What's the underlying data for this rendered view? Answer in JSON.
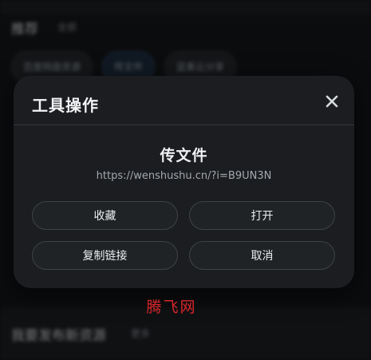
{
  "background": {
    "header_title": "推荐",
    "header_sub": "全部",
    "chips": [
      "百度网盘资源",
      "传文件",
      "蓝奏云分享"
    ],
    "active_chip_index": 1,
    "bottom_title": "我要发布新资源",
    "bottom_sub": "更多"
  },
  "dialog": {
    "title": "工具操作",
    "close_icon": "close-icon",
    "file_name": "传文件",
    "file_url": "https://wenshushu.cn/?i=B9UN3N",
    "actions": {
      "favorite": "收藏",
      "open": "打开",
      "copy_link": "复制链接",
      "cancel": "取消"
    }
  },
  "watermark": "腾飞网",
  "colors": {
    "dialog_bg": "#1b1d20",
    "button_border": "#3e4246",
    "watermark": "#d9262a"
  }
}
